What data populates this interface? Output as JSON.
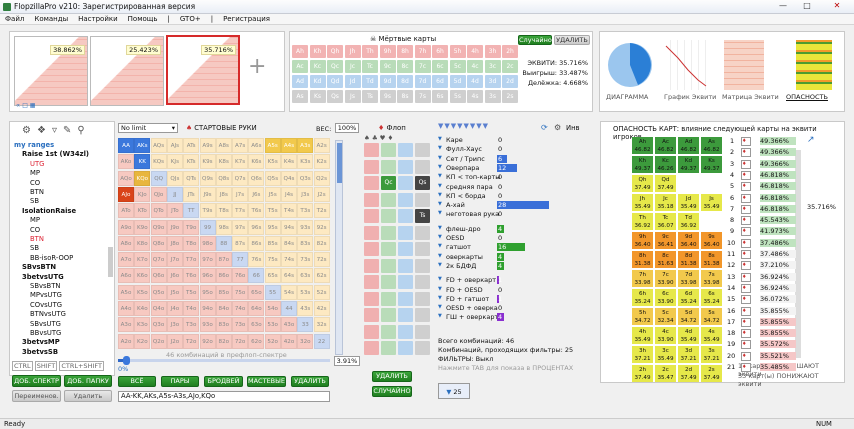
{
  "title": "FlopzillaPro v210: Зарегистрированная версия",
  "menu": [
    "Файл",
    "Команды",
    "Настройки",
    "Помощь",
    "|",
    "GTO+",
    "|",
    "Регистрация"
  ],
  "ranges": [
    {
      "pct": "38.862%"
    },
    {
      "pct": "25.423%"
    },
    {
      "pct": "35.716%"
    }
  ],
  "plus_label": "+",
  "dead_cards": {
    "title": "Мёртвые карты",
    "random_label": "Случайно",
    "delete_label": "УДАЛИТЬ"
  },
  "dead_grid": [
    [
      "Ah",
      "Kh",
      "Qh",
      "Jh",
      "Th",
      "9h",
      "8h",
      "7h",
      "6h",
      "5h",
      "4h",
      "3h",
      "2h"
    ],
    [
      "Ac",
      "Kc",
      "Qc",
      "Jc",
      "Tc",
      "9c",
      "8c",
      "7c",
      "6c",
      "5c",
      "4c",
      "3c",
      "2c"
    ],
    [
      "Ad",
      "Kd",
      "Qd",
      "Jd",
      "Td",
      "9d",
      "8d",
      "7d",
      "6d",
      "5d",
      "4d",
      "3d",
      "2d"
    ],
    [
      "As",
      "Ks",
      "Qs",
      "Js",
      "Ts",
      "9s",
      "8s",
      "7s",
      "6s",
      "5s",
      "4s",
      "3s",
      "2s"
    ]
  ],
  "equity": {
    "line1": "ЭКВИТИ: 35.716%",
    "line2": "Выигрыш: 33.487%",
    "line3": "Делёжка: 4.668%"
  },
  "views": [
    {
      "label": "ДИАГРАММА"
    },
    {
      "label": "График Эквити"
    },
    {
      "label": "Матрица Эквити"
    },
    {
      "label": "ОПАСНОСТЬ"
    }
  ],
  "tree": {
    "items": [
      "my ranges",
      "Raise 1st (W34zl)",
      "UTG",
      "MP",
      "CO",
      "BTN",
      "SB",
      "IsolationRaise",
      "MP",
      "CO",
      "BTN",
      "SB",
      "BB-isoR-OOP",
      "SBvsBTN",
      "3betvsUTG",
      "SBvsBTN",
      "MPvsUTG",
      "COvsUTG",
      "BTNvsUTG",
      "SBvsUTG",
      "BBvsUTG",
      "3betvsMP",
      "3betvsSB"
    ],
    "ctrl": "CTRL",
    "shift": "SHIFT",
    "ctrlshift": "CTRL+SHIFT",
    "btn_spectr": "ДОБ. СПЕКТР",
    "btn_folder": "ДОБ. ПАПКУ",
    "btn_rename": "Переименов.",
    "btn_delete": "Удалить"
  },
  "range": {
    "limit": "No limit",
    "start_label": "СТАРТОВЫЕ РУКИ",
    "weight_label": "ВЕС:",
    "weight": "100%",
    "combos_label": "46 комбинаций в префлоп-спектре",
    "slider_pct": "3.91%",
    "slider_min": "0%",
    "buttons": [
      "ВСЁ",
      "ПАРЫ",
      "БРОДВЕЙ",
      "МАСТЕВЫЕ",
      "УДАЛИТЬ"
    ],
    "text": "AA-KK,AKs,A5s-A3s,AJo,KQo"
  },
  "matrix_rows": [
    [
      "AA",
      "AKs",
      "AQs",
      "AJs",
      "ATs",
      "A9s",
      "A8s",
      "A7s",
      "A6s",
      "A5s",
      "A4s",
      "A3s",
      "A2s"
    ],
    [
      "AKo",
      "KK",
      "KQs",
      "KJs",
      "KTs",
      "K9s",
      "K8s",
      "K7s",
      "K6s",
      "K5s",
      "K4s",
      "K3s",
      "K2s"
    ],
    [
      "AQo",
      "KQo",
      "QQ",
      "QJs",
      "QTs",
      "Q9s",
      "Q8s",
      "Q7s",
      "Q6s",
      "Q5s",
      "Q4s",
      "Q3s",
      "Q2s"
    ],
    [
      "AJo",
      "KJo",
      "QJo",
      "JJ",
      "JTs",
      "J9s",
      "J8s",
      "J7s",
      "J6s",
      "J5s",
      "J4s",
      "J3s",
      "J2s"
    ],
    [
      "ATo",
      "KTo",
      "QTo",
      "JTo",
      "TT",
      "T9s",
      "T8s",
      "T7s",
      "T6s",
      "T5s",
      "T4s",
      "T3s",
      "T2s"
    ],
    [
      "A9o",
      "K9o",
      "Q9o",
      "J9o",
      "T9o",
      "99",
      "98s",
      "97s",
      "96s",
      "95s",
      "94s",
      "93s",
      "92s"
    ],
    [
      "A8o",
      "K8o",
      "Q8o",
      "J8o",
      "T8o",
      "98o",
      "88",
      "87s",
      "86s",
      "85s",
      "84s",
      "83s",
      "82s"
    ],
    [
      "A7o",
      "K7o",
      "Q7o",
      "J7o",
      "T7o",
      "97o",
      "87o",
      "77",
      "76s",
      "75s",
      "74s",
      "73s",
      "72s"
    ],
    [
      "A6o",
      "K6o",
      "Q6o",
      "J6o",
      "T6o",
      "96o",
      "86o",
      "76o",
      "66",
      "65s",
      "64s",
      "63s",
      "62s"
    ],
    [
      "A5o",
      "K5o",
      "Q5o",
      "J5o",
      "T5o",
      "95o",
      "85o",
      "75o",
      "65o",
      "55",
      "54s",
      "53s",
      "52s"
    ],
    [
      "A4o",
      "K4o",
      "Q4o",
      "J4o",
      "T4o",
      "94o",
      "84o",
      "74o",
      "64o",
      "54o",
      "44",
      "43s",
      "42s"
    ],
    [
      "A3o",
      "K3o",
      "Q3o",
      "J3o",
      "T3o",
      "93o",
      "83o",
      "73o",
      "63o",
      "53o",
      "43o",
      "33",
      "32s"
    ],
    [
      "A2o",
      "K2o",
      "Q2o",
      "J2o",
      "T2o",
      "92o",
      "82o",
      "72o",
      "62o",
      "52o",
      "42o",
      "32o",
      "22"
    ]
  ],
  "flop": {
    "label": "Флоп",
    "delete_label": "УДАЛИТЬ",
    "random_label": "СЛУЧАЙНО",
    "selected": [
      "Qc",
      "Qs",
      "Ts"
    ]
  },
  "flop_ranks": [
    "A",
    "K",
    "Q",
    "J",
    "T",
    "9",
    "8",
    "7",
    "6",
    "5",
    "4",
    "3",
    "2"
  ],
  "filters": [
    {
      "name": "Каре",
      "val": "0",
      "w": 0,
      "c": "b"
    },
    {
      "name": "Фулл-Хаус",
      "val": "0",
      "w": 0,
      "c": "b"
    },
    {
      "name": "Сет / Трипс",
      "val": "6",
      "w": 10,
      "c": "b"
    },
    {
      "name": "Оверпара",
      "val": "12",
      "w": 20,
      "c": "b"
    },
    {
      "name": "КП < топ-карты",
      "val": "0",
      "w": 0,
      "c": "b"
    },
    {
      "name": "средняя пара",
      "val": "0",
      "w": 0,
      "c": "b"
    },
    {
      "name": "КП < борда",
      "val": "0",
      "w": 0,
      "c": "b"
    },
    {
      "name": "А-хай",
      "val": "28",
      "w": 52,
      "c": "b"
    },
    {
      "name": "неготовая рука",
      "val": "0",
      "w": 0,
      "c": "b"
    },
    {
      "name": "флеш-дро",
      "val": "4",
      "w": 7,
      "c": "g"
    },
    {
      "name": "OESD",
      "val": "0",
      "w": 0,
      "c": "g"
    },
    {
      "name": "гатшот",
      "val": "16",
      "w": 28,
      "c": "g"
    },
    {
      "name": "оверкарты",
      "val": "4",
      "w": 7,
      "c": "g"
    },
    {
      "name": "2к БДФД",
      "val": "4",
      "w": 7,
      "c": "g"
    },
    {
      "name": "FD + оверкарт",
      "val": "1",
      "w": 2,
      "c": "p"
    },
    {
      "name": "FD + OESD",
      "val": "0",
      "w": 0,
      "c": "p"
    },
    {
      "name": "FD + гатшот",
      "val": "1",
      "w": 2,
      "c": "p"
    },
    {
      "name": "OESD + оверка",
      "val": "0",
      "w": 0,
      "c": "p"
    },
    {
      "name": "ГШ + оверкарт",
      "val": "4",
      "w": 7,
      "c": "p"
    }
  ],
  "filter_summary": {
    "total": "Всего комбинаций: 46",
    "passing": "Комбинаций, проходящих фильтры: 25",
    "filters": "ФИЛЬТРЫ: Выкл",
    "hint": "Нажмите TAB для показа в ПРОЦЕНТАХ",
    "inv": "Инв",
    "count": "25"
  },
  "danger": {
    "title": "ОПАСНОСТЬ КАРТ: влияние следующей карты на эквити игроков",
    "current": "35.716%",
    "footer1": "16 карт(ы) ПОВЫШАЮТ эквити",
    "footer2": "33 карт(ы) ПОНИЖАЮТ эквити"
  },
  "danger_grid": [
    [
      "Ah 46.82",
      "Ac 46.82",
      "Ad 46.82",
      "As 46.82"
    ],
    [
      "Kh 49.37",
      "Kc 46.26",
      "Kd 49.37",
      "Ks 49.37"
    ],
    [
      "Qh 37.49",
      "Qd 37.49",
      "",
      ""
    ],
    [
      "Jh 35.49",
      "Jc 35.18",
      "Jd 35.49",
      "Js 35.49"
    ],
    [
      "Th 36.92",
      "Tc 36.07",
      "Td 36.92",
      ""
    ],
    [
      "9h 36.40",
      "9c 36.41",
      "9d 36.40",
      "9s 36.40"
    ],
    [
      "8h 31.38",
      "8c 31.63",
      "8d 31.38",
      "8s 31.38"
    ],
    [
      "7h 33.98",
      "7c 33.90",
      "7d 33.98",
      "7s 33.98"
    ],
    [
      "6h 35.24",
      "6c 33.90",
      "6d 35.24",
      "6s 35.24"
    ],
    [
      "5h 34.72",
      "5c 32.34",
      "5d 34.72",
      "5s 34.72"
    ],
    [
      "4h 35.49",
      "4c 33.90",
      "4d 35.49",
      "4s 35.49"
    ],
    [
      "3h 37.21",
      "3c 35.49",
      "3d 37.21",
      "3s 37.21"
    ],
    [
      "2h 37.49",
      "2c 35.47",
      "2d 37.49",
      "2s 37.49"
    ]
  ],
  "danger_list": [
    {
      "n": "1",
      "v": "49.366%"
    },
    {
      "n": "2",
      "v": "49.366%"
    },
    {
      "n": "3",
      "v": "49.366%"
    },
    {
      "n": "4",
      "v": "46.818%"
    },
    {
      "n": "5",
      "v": "46.818%"
    },
    {
      "n": "6",
      "v": "46.818%"
    },
    {
      "n": "7",
      "v": "46.818%"
    },
    {
      "n": "8",
      "v": "45.543%"
    },
    {
      "n": "9",
      "v": "41.973%"
    },
    {
      "n": "10",
      "v": "37.486%"
    },
    {
      "n": "11",
      "v": "37.486%"
    },
    {
      "n": "12",
      "v": "37.210%"
    },
    {
      "n": "13",
      "v": "36.924%"
    },
    {
      "n": "14",
      "v": "36.924%"
    },
    {
      "n": "15",
      "v": "36.072%"
    },
    {
      "n": "16",
      "v": "35.855%"
    },
    {
      "n": "17",
      "v": "35.855%"
    },
    {
      "n": "18",
      "v": "35.855%"
    },
    {
      "n": "19",
      "v": "35.572%"
    },
    {
      "n": "20",
      "v": "35.521%"
    },
    {
      "n": "21",
      "v": "35.485%"
    }
  ],
  "status": {
    "left": "Ready",
    "right": "NUM"
  }
}
